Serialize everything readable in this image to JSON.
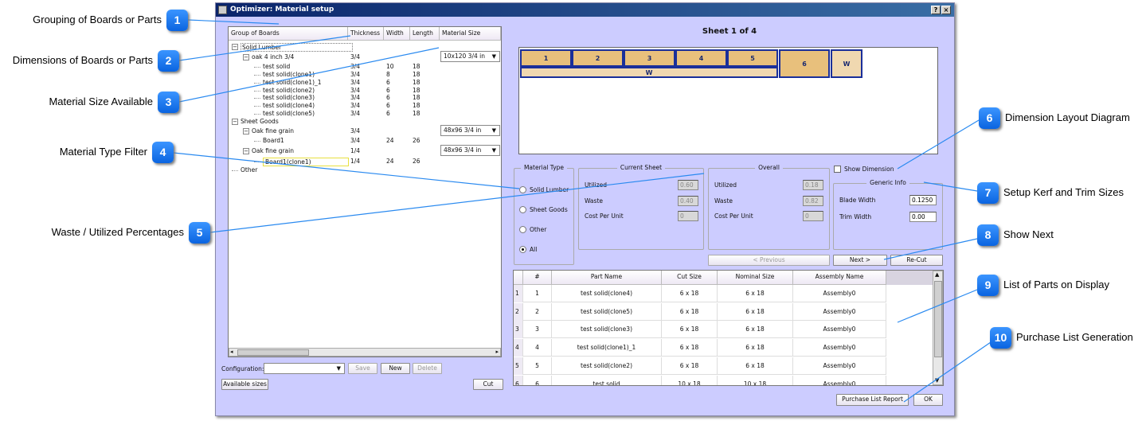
{
  "window": {
    "title": "Optimizer: Material setup",
    "help": "?",
    "close": "×"
  },
  "tree": {
    "headers": [
      "Group of Boards",
      "Thickness",
      "Width",
      "Length",
      "Material Size"
    ],
    "rows": [
      {
        "level": 0,
        "label": "Solid Lumber",
        "t": "",
        "w": "",
        "l": "",
        "size": "",
        "selected": true
      },
      {
        "level": 1,
        "label": "oak 4 inch 3/4",
        "t": "3/4",
        "w": "",
        "l": "",
        "size": "10x120 3/4 in"
      },
      {
        "level": 2,
        "label": "test solid",
        "t": "3/4",
        "w": "10",
        "l": "18"
      },
      {
        "level": 2,
        "label": "test solid(clone1)",
        "t": "3/4",
        "w": "8",
        "l": "18"
      },
      {
        "level": 2,
        "label": "test solid(clone1)_1",
        "t": "3/4",
        "w": "6",
        "l": "18"
      },
      {
        "level": 2,
        "label": "test solid(clone2)",
        "t": "3/4",
        "w": "6",
        "l": "18"
      },
      {
        "level": 2,
        "label": "test solid(clone3)",
        "t": "3/4",
        "w": "6",
        "l": "18"
      },
      {
        "level": 2,
        "label": "test solid(clone4)",
        "t": "3/4",
        "w": "6",
        "l": "18"
      },
      {
        "level": 2,
        "label": "test solid(clone5)",
        "t": "3/4",
        "w": "6",
        "l": "18"
      },
      {
        "level": 0,
        "label": "Sheet Goods",
        "t": "",
        "w": "",
        "l": ""
      },
      {
        "level": 1,
        "label": "Oak fine grain",
        "t": "3/4",
        "w": "",
        "l": "",
        "size": "48x96 3/4 in"
      },
      {
        "level": 2,
        "label": "Board1",
        "t": "3/4",
        "w": "24",
        "l": "26"
      },
      {
        "level": 1,
        "label": "Oak fine grain",
        "t": "1/4",
        "w": "",
        "l": "",
        "size": "48x96 3/4 in"
      },
      {
        "level": 2,
        "label": "Board1(clone1)",
        "t": "1/4",
        "w": "24",
        "l": "26",
        "editing": true
      },
      {
        "level": 0,
        "label": "Other",
        "t": "",
        "w": "",
        "l": ""
      }
    ]
  },
  "config": {
    "label": "Configuration:",
    "value": "",
    "save": "Save",
    "new": "New",
    "delete": "Delete",
    "available": "Available sizes",
    "cut": "Cut"
  },
  "sheet": {
    "title": "Sheet 1 of 4",
    "pieces": [
      "1",
      "2",
      "3",
      "4",
      "5",
      "W",
      "6",
      "W"
    ],
    "piece_color": "#e8c07c",
    "waste_color": "#f0d8b0",
    "border_color": "#1a2f9a"
  },
  "material_type": {
    "title": "Material Type",
    "options": [
      "Solid Lumber",
      "Sheet Goods",
      "Other",
      "All"
    ],
    "selected": "All"
  },
  "current_sheet": {
    "title": "Current Sheet",
    "utilized_label": "Utilized",
    "utilized": "0.60",
    "waste_label": "Waste",
    "waste": "0.40",
    "cost_label": "Cost Per Unit",
    "cost": "0"
  },
  "overall": {
    "title": "Overall",
    "utilized_label": "Utilized",
    "utilized": "0.18",
    "waste_label": "Waste",
    "waste": "0.82",
    "cost_label": "Cost Per Unit",
    "cost": "0"
  },
  "show_dimension": {
    "label": "Show Dimension",
    "checked": false
  },
  "generic": {
    "title": "Generic Info",
    "blade_label": "Blade Width",
    "blade": "0.1250",
    "trim_label": "Trim Width",
    "trim": "0.00"
  },
  "nav": {
    "previous": "< Previous",
    "next": "Next >",
    "recut": "Re-Cut"
  },
  "parts": {
    "headers": [
      "#",
      "Part Name",
      "Cut Size",
      "Nominal Size",
      "Assembly Name"
    ],
    "rows": [
      [
        "1",
        "1",
        "test solid(clone4)",
        "6 x 18",
        "6 x 18",
        "Assembly0"
      ],
      [
        "2",
        "2",
        "test solid(clone5)",
        "6 x 18",
        "6 x 18",
        "Assembly0"
      ],
      [
        "3",
        "3",
        "test solid(clone3)",
        "6 x 18",
        "6 x 18",
        "Assembly0"
      ],
      [
        "4",
        "4",
        "test solid(clone1)_1",
        "6 x 18",
        "6 x 18",
        "Assembly0"
      ],
      [
        "5",
        "5",
        "test solid(clone2)",
        "6 x 18",
        "6 x 18",
        "Assembly0"
      ],
      [
        "6",
        "6",
        "test solid",
        "10 x 18",
        "10 x 18",
        "Assembly0"
      ]
    ]
  },
  "footer": {
    "purchase": "Purchase List Report",
    "ok": "OK"
  },
  "callouts": [
    {
      "n": "1",
      "text": "Grouping of Boards or Parts"
    },
    {
      "n": "2",
      "text": "Dimensions of Boards or Parts"
    },
    {
      "n": "3",
      "text": "Material Size Available"
    },
    {
      "n": "4",
      "text": "Material Type Filter"
    },
    {
      "n": "5",
      "text": "Waste / Utilized Percentages"
    },
    {
      "n": "6",
      "text": "Dimension Layout Diagram"
    },
    {
      "n": "7",
      "text": "Setup Kerf and Trim Sizes"
    },
    {
      "n": "8",
      "text": "Show Next"
    },
    {
      "n": "9",
      "text": "List of Parts on Display"
    },
    {
      "n": "10",
      "text": "Purchase List Generation"
    }
  ],
  "accent": "#0a64e0"
}
